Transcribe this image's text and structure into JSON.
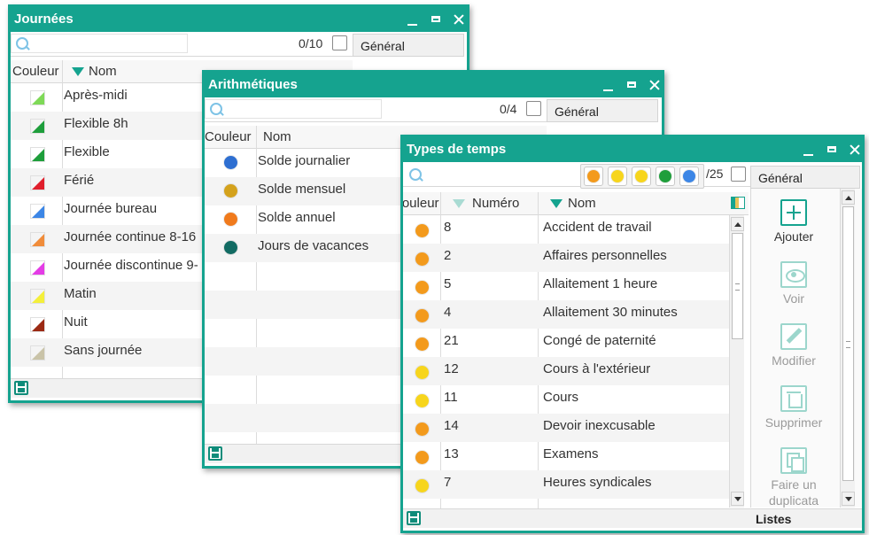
{
  "journees": {
    "title": "Journées",
    "count": "0/10",
    "tab": "Général",
    "col_couleur": "Couleur",
    "col_nom": "Nom",
    "rows": [
      {
        "nom": "Après-midi",
        "color": "#7ed957"
      },
      {
        "nom": "Flexible 8h",
        "color": "#1e9e3b"
      },
      {
        "nom": "Flexible",
        "color": "#1e9e3b"
      },
      {
        "nom": "Férié",
        "color": "#e01e2b"
      },
      {
        "nom": "Journée bureau",
        "color": "#3c86e6"
      },
      {
        "nom": "Journée continue 8-16",
        "color": "#f08c3a"
      },
      {
        "nom": "Journée discontinue 9-",
        "color": "#e43ce6"
      },
      {
        "nom": "Matin",
        "color": "#f4ef3a"
      },
      {
        "nom": "Nuit",
        "color": "#9b2a14"
      },
      {
        "nom": "Sans journée",
        "color": "#c9c3a8"
      }
    ]
  },
  "arithmetiques": {
    "title": "Arithmétiques",
    "count": "0/4",
    "tab": "Général",
    "col_couleur": "Couleur",
    "col_nom": "Nom",
    "rows": [
      {
        "nom": "Solde journalier",
        "color": "#2e6fd1"
      },
      {
        "nom": "Solde mensuel",
        "color": "#d4a21c"
      },
      {
        "nom": "Solde annuel",
        "color": "#f07a1c"
      },
      {
        "nom": "Jours de vacances",
        "color": "#126b63"
      }
    ]
  },
  "types": {
    "title": "Types de temps",
    "count": "/25",
    "tab": "Général",
    "col_couleur": "Couleur",
    "col_numero": "Numéro",
    "col_nom": "Nom",
    "filters": [
      "#f39a1c",
      "#f7d51c",
      "#f7d51c",
      "#1f9e3b",
      "#3c86e6"
    ],
    "rows": [
      {
        "num": "8",
        "nom": "Accident de travail",
        "color": "#f39a1c"
      },
      {
        "num": "2",
        "nom": "Affaires personnelles",
        "color": "#f39a1c"
      },
      {
        "num": "5",
        "nom": "Allaitement 1 heure",
        "color": "#f39a1c"
      },
      {
        "num": "4",
        "nom": "Allaitement 30 minutes",
        "color": "#f39a1c"
      },
      {
        "num": "21",
        "nom": "Congé de paternité",
        "color": "#f39a1c"
      },
      {
        "num": "12",
        "nom": "Cours à l'extérieur",
        "color": "#f7d51c"
      },
      {
        "num": "11",
        "nom": "Cours",
        "color": "#f7d51c"
      },
      {
        "num": "14",
        "nom": "Devoir inexcusable",
        "color": "#f39a1c"
      },
      {
        "num": "13",
        "nom": "Examens",
        "color": "#f39a1c"
      },
      {
        "num": "7",
        "nom": "Heures syndicales",
        "color": "#f7d51c"
      }
    ],
    "actions": {
      "ajouter": "Ajouter",
      "voir": "Voir",
      "modifier": "Modifier",
      "supprimer": "Supprimer",
      "dupliquer_1": "Faire un",
      "dupliquer_2": "duplicata"
    },
    "listes": "Listes"
  },
  "accent_color": "#15a38f"
}
